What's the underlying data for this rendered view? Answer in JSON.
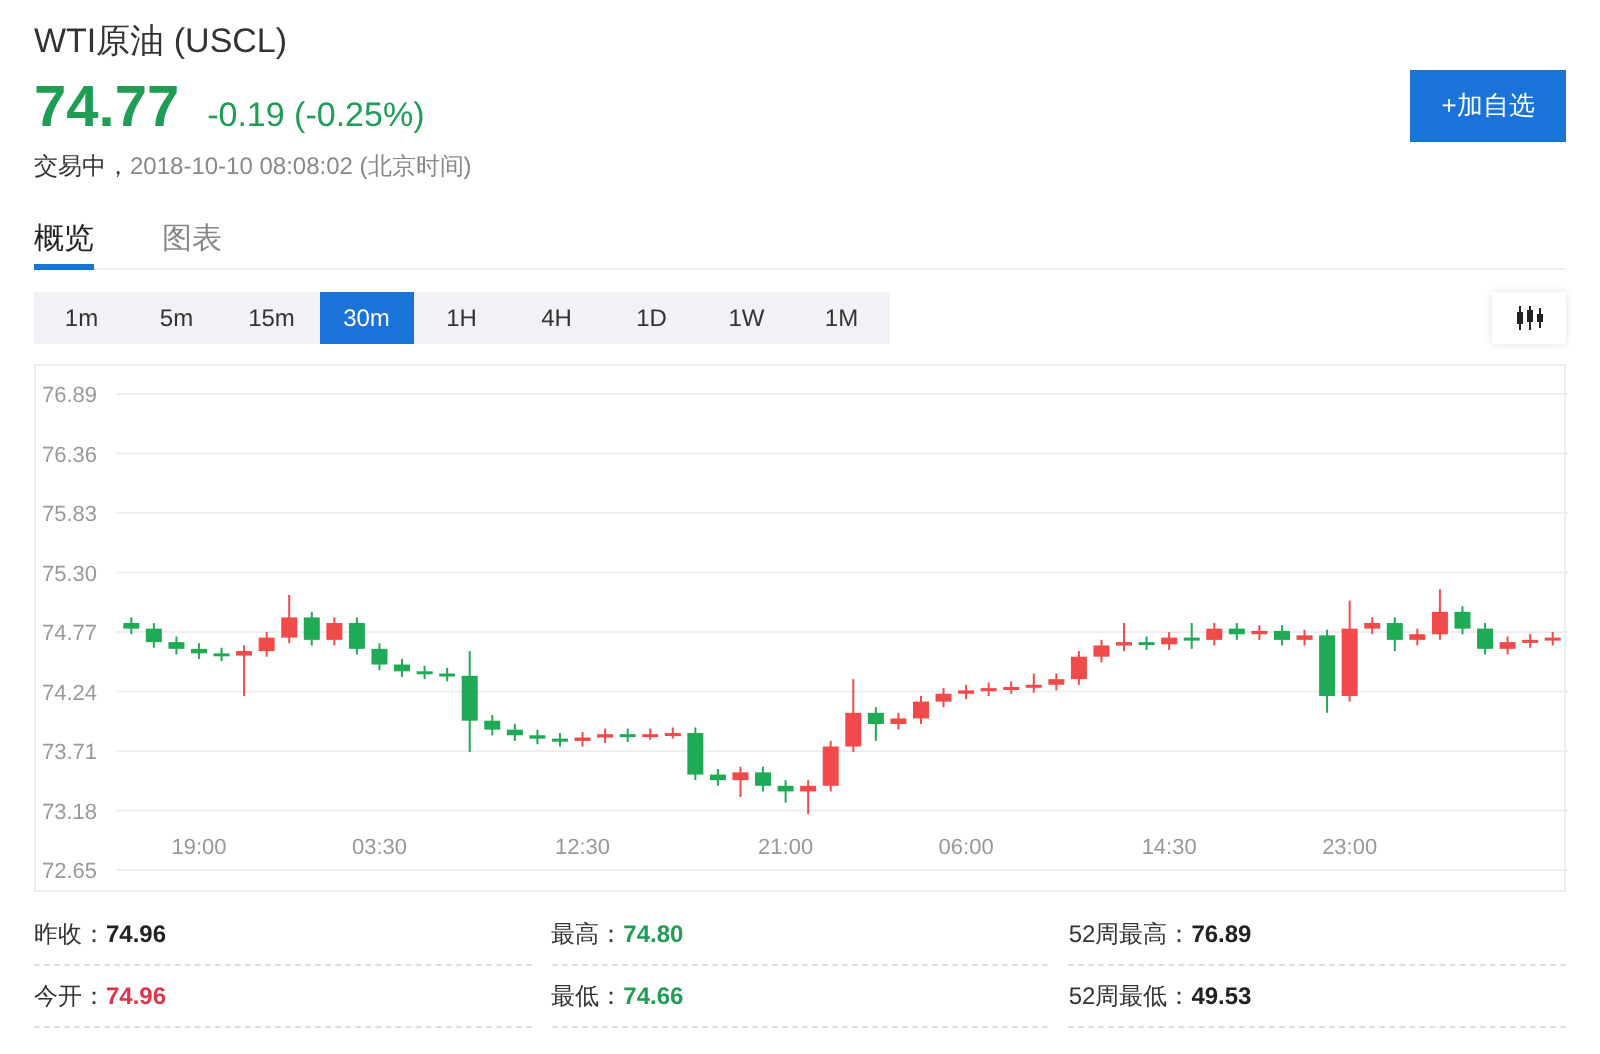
{
  "quote": {
    "title": "WTI原油 (USCL)",
    "price": "74.77",
    "change": "-0.19 (-0.25%)",
    "status": "交易中，",
    "timestamp": "2018-10-10 08:08:02 (北京时间)"
  },
  "watch_button": "+加自选",
  "tabs": [
    {
      "label": "概览",
      "selected": true
    },
    {
      "label": "图表",
      "selected": false
    }
  ],
  "intervals": [
    {
      "label": "1m",
      "selected": false
    },
    {
      "label": "5m",
      "selected": false
    },
    {
      "label": "15m",
      "selected": false
    },
    {
      "label": "30m",
      "selected": true
    },
    {
      "label": "1H",
      "selected": false
    },
    {
      "label": "4H",
      "selected": false
    },
    {
      "label": "1D",
      "selected": false
    },
    {
      "label": "1W",
      "selected": false
    },
    {
      "label": "1M",
      "selected": false
    }
  ],
  "chart_data": {
    "type": "candlestick",
    "grid": true,
    "ylim": [
      72.65,
      76.89
    ],
    "yticks": [
      {
        "value": 76.89,
        "label": "76.89"
      },
      {
        "value": 76.36,
        "label": "76.36"
      },
      {
        "value": 75.83,
        "label": "75.83"
      },
      {
        "value": 75.3,
        "label": "75.30"
      },
      {
        "value": 74.77,
        "label": "74.77"
      },
      {
        "value": 74.24,
        "label": "74.24"
      },
      {
        "value": 73.71,
        "label": "73.71"
      },
      {
        "value": 73.18,
        "label": "73.18"
      },
      {
        "value": 72.65,
        "label": "72.65"
      }
    ],
    "categories": [
      null,
      null,
      null,
      "19:00",
      null,
      null,
      null,
      null,
      null,
      null,
      null,
      "03:30",
      null,
      null,
      null,
      null,
      null,
      null,
      null,
      null,
      "12:30",
      null,
      null,
      null,
      null,
      null,
      null,
      null,
      null,
      "21:00",
      null,
      null,
      null,
      null,
      null,
      null,
      null,
      "06:00",
      null,
      null,
      null,
      null,
      null,
      null,
      null,
      null,
      "14:30",
      null,
      null,
      null,
      null,
      null,
      null,
      null,
      "23:00",
      null,
      null,
      null,
      null,
      null,
      null,
      null,
      null,
      null
    ],
    "ohlc": [
      [
        74.85,
        74.9,
        74.75,
        74.8
      ],
      [
        74.8,
        74.85,
        74.63,
        74.68
      ],
      [
        74.68,
        74.73,
        74.57,
        74.62
      ],
      [
        74.62,
        74.67,
        74.53,
        74.58
      ],
      [
        74.58,
        74.63,
        74.51,
        74.56
      ],
      [
        74.56,
        74.65,
        74.2,
        74.6
      ],
      [
        74.6,
        74.77,
        74.55,
        74.72
      ],
      [
        74.72,
        75.1,
        74.67,
        74.9
      ],
      [
        74.9,
        74.95,
        74.65,
        74.7
      ],
      [
        74.7,
        74.9,
        74.65,
        74.85
      ],
      [
        74.85,
        74.9,
        74.57,
        74.62
      ],
      [
        74.62,
        74.67,
        74.43,
        74.48
      ],
      [
        74.48,
        74.53,
        74.37,
        74.42
      ],
      [
        74.42,
        74.47,
        74.35,
        74.4
      ],
      [
        74.4,
        74.45,
        74.33,
        74.38
      ],
      [
        74.38,
        74.6,
        73.7,
        73.98
      ],
      [
        73.98,
        74.03,
        73.85,
        73.9
      ],
      [
        73.9,
        73.95,
        73.8,
        73.85
      ],
      [
        73.85,
        73.9,
        73.77,
        73.82
      ],
      [
        73.82,
        73.87,
        73.75,
        73.8
      ],
      [
        73.8,
        73.88,
        73.75,
        73.83
      ],
      [
        73.83,
        73.91,
        73.78,
        73.86
      ],
      [
        73.86,
        73.91,
        73.79,
        73.84
      ],
      [
        73.84,
        73.91,
        73.81,
        73.86
      ],
      [
        73.86,
        73.92,
        73.82,
        73.87
      ],
      [
        73.87,
        73.92,
        73.45,
        73.5
      ],
      [
        73.5,
        73.55,
        73.4,
        73.45
      ],
      [
        73.45,
        73.57,
        73.3,
        73.52
      ],
      [
        73.52,
        73.57,
        73.35,
        73.4
      ],
      [
        73.4,
        73.45,
        73.25,
        73.35
      ],
      [
        73.35,
        73.45,
        73.15,
        73.4
      ],
      [
        73.4,
        73.8,
        73.35,
        73.75
      ],
      [
        73.75,
        74.35,
        73.7,
        74.05
      ],
      [
        74.05,
        74.1,
        73.8,
        73.95
      ],
      [
        73.95,
        74.05,
        73.9,
        74.0
      ],
      [
        74.0,
        74.2,
        73.95,
        74.15
      ],
      [
        74.15,
        74.27,
        74.1,
        74.22
      ],
      [
        74.22,
        74.3,
        74.17,
        74.25
      ],
      [
        74.25,
        74.32,
        74.2,
        74.27
      ],
      [
        74.27,
        74.33,
        74.22,
        74.28
      ],
      [
        74.28,
        74.4,
        74.23,
        74.3
      ],
      [
        74.3,
        74.4,
        74.25,
        74.35
      ],
      [
        74.35,
        74.6,
        74.3,
        74.55
      ],
      [
        74.55,
        74.7,
        74.5,
        74.65
      ],
      [
        74.65,
        74.85,
        74.6,
        74.68
      ],
      [
        74.68,
        74.73,
        74.61,
        74.66
      ],
      [
        74.66,
        74.77,
        74.61,
        74.72
      ],
      [
        74.72,
        74.85,
        74.62,
        74.7
      ],
      [
        74.7,
        74.85,
        74.65,
        74.8
      ],
      [
        74.8,
        74.85,
        74.7,
        74.75
      ],
      [
        74.75,
        74.83,
        74.7,
        74.78
      ],
      [
        74.78,
        74.83,
        74.65,
        74.7
      ],
      [
        74.7,
        74.79,
        74.65,
        74.74
      ],
      [
        74.74,
        74.79,
        74.05,
        74.2
      ],
      [
        74.2,
        75.05,
        74.15,
        74.8
      ],
      [
        74.8,
        74.9,
        74.75,
        74.85
      ],
      [
        74.85,
        74.9,
        74.6,
        74.7
      ],
      [
        74.7,
        74.8,
        74.65,
        74.75
      ],
      [
        74.75,
        75.15,
        74.7,
        74.95
      ],
      [
        74.95,
        75.0,
        74.75,
        74.8
      ],
      [
        74.8,
        74.85,
        74.57,
        74.62
      ],
      [
        74.62,
        74.73,
        74.57,
        74.68
      ],
      [
        74.68,
        74.75,
        74.63,
        74.7
      ],
      [
        74.7,
        74.77,
        74.65,
        74.72
      ]
    ]
  },
  "stats": [
    {
      "label": "昨收：",
      "value": "74.96",
      "color": "#222222"
    },
    {
      "label": "最高：",
      "value": "74.80",
      "color": "#1f9d55"
    },
    {
      "label": "52周最高：",
      "value": "76.89",
      "color": "#222222"
    },
    {
      "label": "今开：",
      "value": "74.96",
      "color": "#e0344b"
    },
    {
      "label": "最低：",
      "value": "74.66",
      "color": "#1f9d55"
    },
    {
      "label": "52周最低：",
      "value": "49.53",
      "color": "#222222"
    }
  ]
}
